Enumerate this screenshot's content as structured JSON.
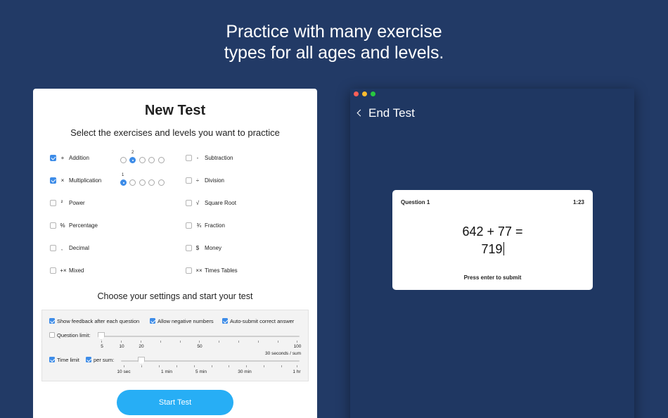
{
  "headline": {
    "line1": "Practice with many exercise",
    "line2": "types for all ages and levels."
  },
  "new_test": {
    "title": "New Test",
    "subtitle": "Select the exercises and levels you want to practice",
    "exercises": [
      {
        "symbol": "+",
        "label": "Addition",
        "checked": true
      },
      {
        "symbol": "-",
        "label": "Subtraction",
        "checked": false
      },
      {
        "symbol": "×",
        "label": "Multiplication",
        "checked": true
      },
      {
        "symbol": "÷",
        "label": "Division",
        "checked": false
      },
      {
        "symbol": "²",
        "label": "Power",
        "checked": false
      },
      {
        "symbol": "√",
        "label": "Square Root",
        "checked": false
      },
      {
        "symbol": "%",
        "label": "Percentage",
        "checked": false
      },
      {
        "symbol": "¾",
        "label": "Fraction",
        "checked": false
      },
      {
        "symbol": ",",
        "label": "Decimal",
        "checked": false
      },
      {
        "symbol": "$",
        "label": "Money",
        "checked": false
      },
      {
        "symbol": "+×",
        "label": "Mixed",
        "checked": false
      },
      {
        "symbol": "××",
        "label": "Times Tables",
        "checked": false
      }
    ],
    "levels": {
      "addition_selected_label": "2",
      "multiplication_selected_label": "1"
    },
    "settings_title": "Choose your settings and start your test",
    "settings": {
      "show_feedback": "Show feedback after each question",
      "allow_negative": "Allow negative numbers",
      "auto_submit": "Auto-submit correct answer",
      "question_limit": "Question limit:",
      "question_ticks": [
        "5",
        "10",
        "20",
        "50",
        "100"
      ],
      "per_sum_value": "30 seconds / sum",
      "time_limit": "Time limit",
      "per_sum": "per sum:",
      "time_ticks": [
        "10 sec",
        "1 min",
        "5 min",
        "30 min",
        "1 hr"
      ]
    },
    "start_button": "Start Test"
  },
  "test_window": {
    "back_label": "End Test",
    "question_title": "Question 1",
    "timer": "1:23",
    "expression": "642 + 77 =",
    "answer": "719",
    "hint": "Press enter to submit"
  },
  "colors": {
    "background": "#223a66",
    "accent": "#27aef5",
    "checkbox": "#3d8ce8"
  }
}
